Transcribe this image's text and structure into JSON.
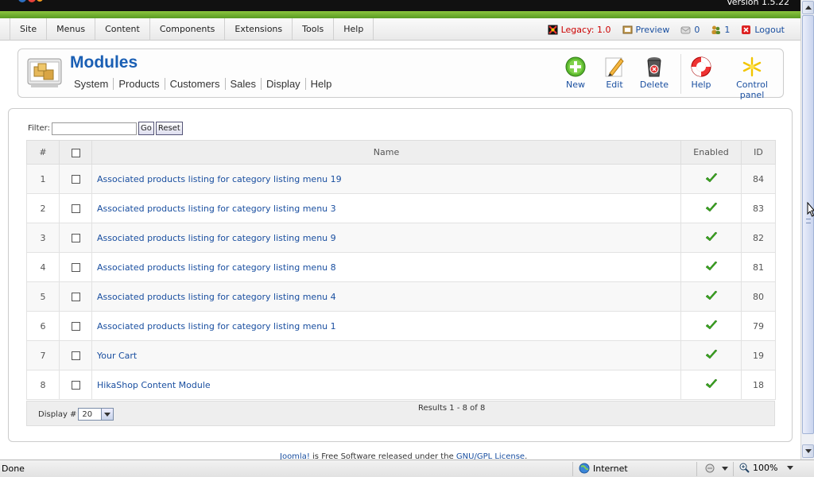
{
  "header": {
    "version": "Version 1.5.22"
  },
  "menu": {
    "items": [
      "Site",
      "Menus",
      "Content",
      "Components",
      "Extensions",
      "Tools",
      "Help"
    ]
  },
  "status": {
    "legacy": "Legacy: 1.0",
    "preview": "Preview",
    "messages": "0",
    "users": "1",
    "logout": "Logout"
  },
  "toolbar": {
    "title": "Modules",
    "submenu": [
      "System",
      "Products",
      "Customers",
      "Sales",
      "Display",
      "Help"
    ],
    "buttons": {
      "new": "New",
      "edit": "Edit",
      "delete": "Delete",
      "help": "Help",
      "control_panel": "Control panel"
    }
  },
  "filter": {
    "label": "Filter:",
    "value": "",
    "go": "Go",
    "reset": "Reset"
  },
  "table": {
    "headers": {
      "num": "#",
      "name": "Name",
      "enabled": "Enabled",
      "id": "ID"
    },
    "rows": [
      {
        "num": "1",
        "name": "Associated products listing for category listing menu 19",
        "enabled": true,
        "id": "84"
      },
      {
        "num": "2",
        "name": "Associated products listing for category listing menu 3",
        "enabled": true,
        "id": "83"
      },
      {
        "num": "3",
        "name": "Associated products listing for category listing menu 9",
        "enabled": true,
        "id": "82"
      },
      {
        "num": "4",
        "name": "Associated products listing for category listing menu 8",
        "enabled": true,
        "id": "81"
      },
      {
        "num": "5",
        "name": "Associated products listing for category listing menu 4",
        "enabled": true,
        "id": "80"
      },
      {
        "num": "6",
        "name": "Associated products listing for category listing menu 1",
        "enabled": true,
        "id": "79"
      },
      {
        "num": "7",
        "name": "Your Cart",
        "enabled": true,
        "id": "19"
      },
      {
        "num": "8",
        "name": "HikaShop Content Module",
        "enabled": true,
        "id": "18"
      }
    ]
  },
  "pagination": {
    "display_label": "Display #",
    "display_value": "20",
    "results": "Results 1 - 8 of 8"
  },
  "footer": {
    "link1": "Joomla!",
    "text": " is Free Software released under the ",
    "link2": "GNU/GPL License",
    "end": "."
  },
  "browser_status": {
    "done": "Done",
    "zone": "Internet",
    "zoom": "100%"
  },
  "colors": {
    "accent": "#1a5fb4",
    "link": "#1a4fa0",
    "green_bar": "#6fae2c",
    "legacy": "#cc0000"
  }
}
